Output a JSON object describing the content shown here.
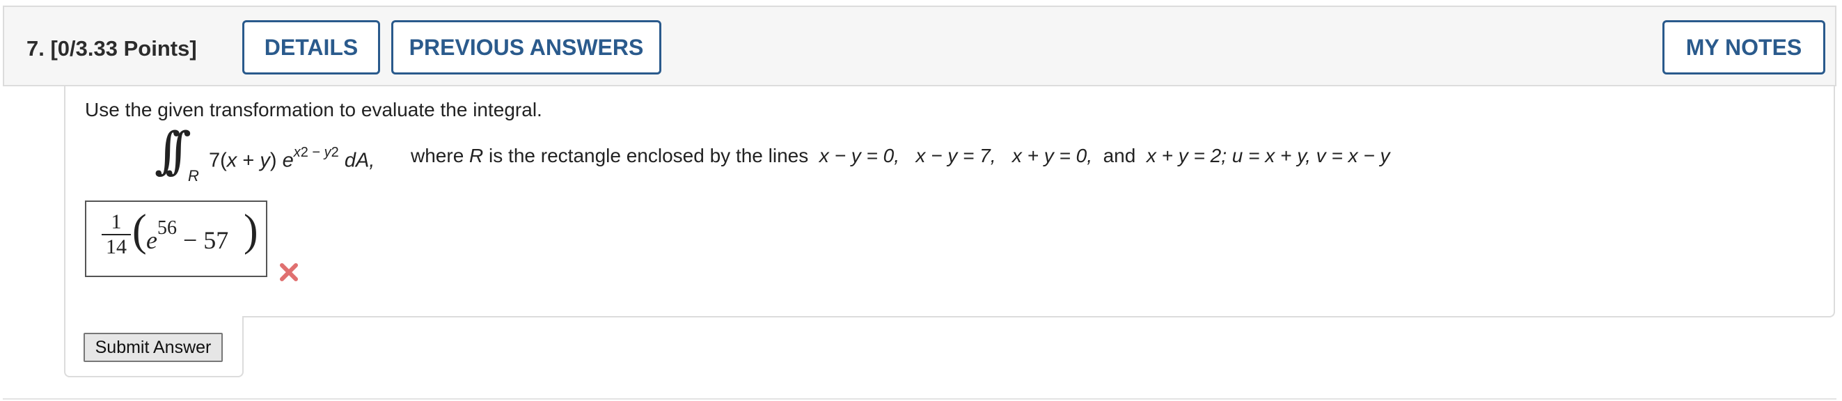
{
  "question": {
    "number_label": "7.",
    "points_label": "[0/3.33 Points]"
  },
  "header_buttons": {
    "details": "DETAILS",
    "previous_answers": "PREVIOUS ANSWERS",
    "my_notes": "MY NOTES"
  },
  "instruction": "Use the given transformation to evaluate the integral.",
  "integral": {
    "region_subscript": "R",
    "coefficient": "7(",
    "var_x": "x",
    "plus": " + ",
    "var_y": "y",
    "close": ") ",
    "base": "e",
    "exp_x": "x",
    "exp_sq1": "2",
    "exp_minus": " − ",
    "exp_y": "y",
    "exp_sq2": "2",
    "differential": " dA,",
    "where_pre": "where ",
    "where_R": "R",
    "where_post": " is the rectangle enclosed by the lines",
    "line1": "x − y = 0,",
    "line2": "x − y = 7,",
    "line3": "x + y = 0,",
    "and": "and",
    "line4": "x + y = 2;",
    "transform_u": "u = x + y,",
    "transform_v": "v = x − y"
  },
  "answer": {
    "frac_num": "1",
    "frac_den": "14",
    "paren_open": "(",
    "paren_close": ")",
    "base": "e",
    "exponent": "56",
    "tail": " − 57",
    "status": "incorrect"
  },
  "icons": {
    "wrong": "close-x-icon",
    "wrong_color": "#e07070"
  },
  "submit_label": "Submit Answer",
  "colors": {
    "accent": "#2a5a8c",
    "header_bg": "#f6f6f6",
    "border": "#dcdcdc"
  }
}
